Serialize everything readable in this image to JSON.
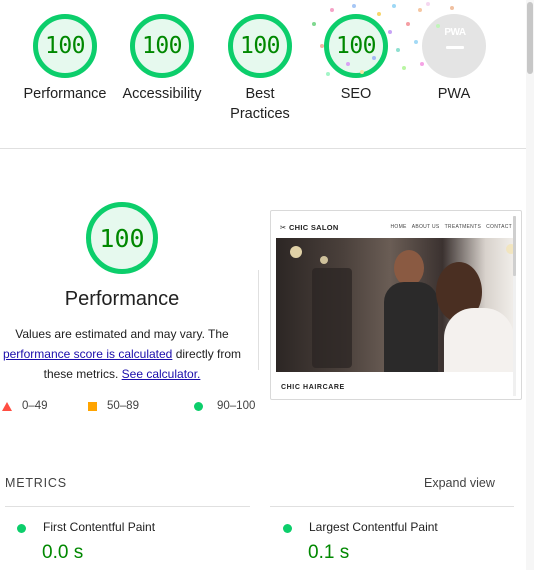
{
  "categories": [
    {
      "label": "Performance",
      "score": "100"
    },
    {
      "label": "Accessibility",
      "score": "100"
    },
    {
      "label": "Best Practices",
      "score": "100"
    },
    {
      "label": "SEO",
      "score": "100"
    },
    {
      "label": "PWA",
      "badge": "PWA"
    }
  ],
  "performance": {
    "score": "100",
    "title": "Performance",
    "desc_prefix": "Values are estimated and may vary. The",
    "desc_link": "performance score is calculated",
    "desc_mid": "directly from these metrics.",
    "calc_link": "See calculator."
  },
  "legend": {
    "fail": "0–49",
    "average": "50–89",
    "pass": "90–100"
  },
  "preview": {
    "logo": "CHIC SALON",
    "nav": [
      "HOME",
      "ABOUT US",
      "TREATMENTS",
      "CONTACT"
    ],
    "caption": "CHIC HAIRCARE"
  },
  "metrics": {
    "header": "METRICS",
    "expand": "Expand view",
    "items": [
      {
        "name": "First Contentful Paint",
        "value": "0.0 s"
      },
      {
        "name": "Largest Contentful Paint",
        "value": "0.1 s"
      }
    ]
  },
  "colors": {
    "pass": "#0cce6b",
    "average": "#ffa400",
    "fail": "#ff4e42",
    "score_text": "#008800"
  }
}
